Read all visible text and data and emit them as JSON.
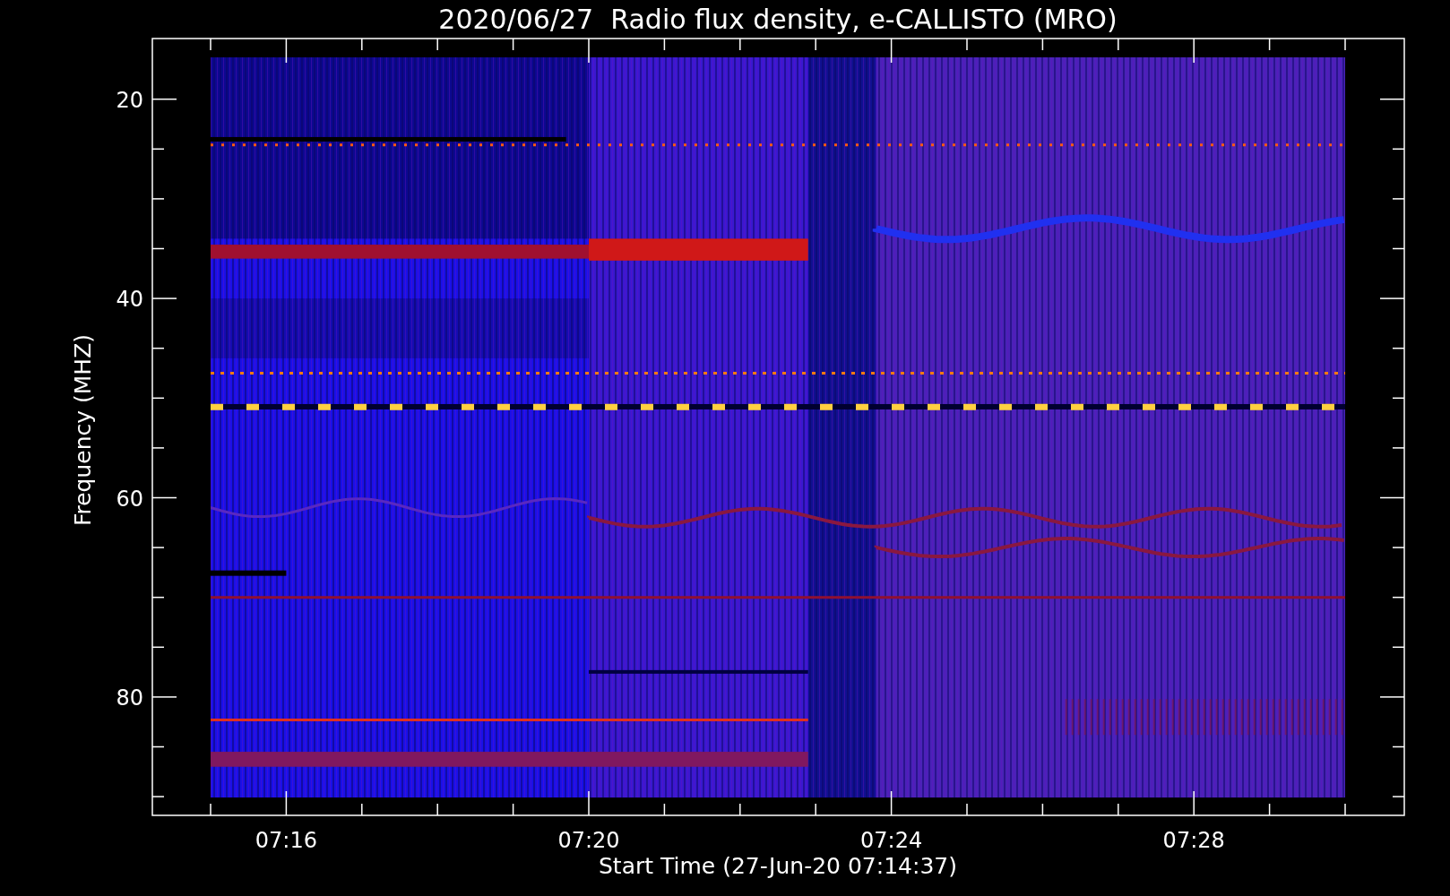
{
  "plot": {
    "title": "2020/06/27  Radio flux density, e-CALLISTO (MRO)",
    "xlabel": "Start Time (27-Jun-20 07:14:37)",
    "ylabel": "Frequency (MHZ)",
    "xticks": [
      "07:16",
      "07:20",
      "07:24",
      "07:28"
    ],
    "yticks": [
      "20",
      "40",
      "60",
      "80"
    ]
  }
}
